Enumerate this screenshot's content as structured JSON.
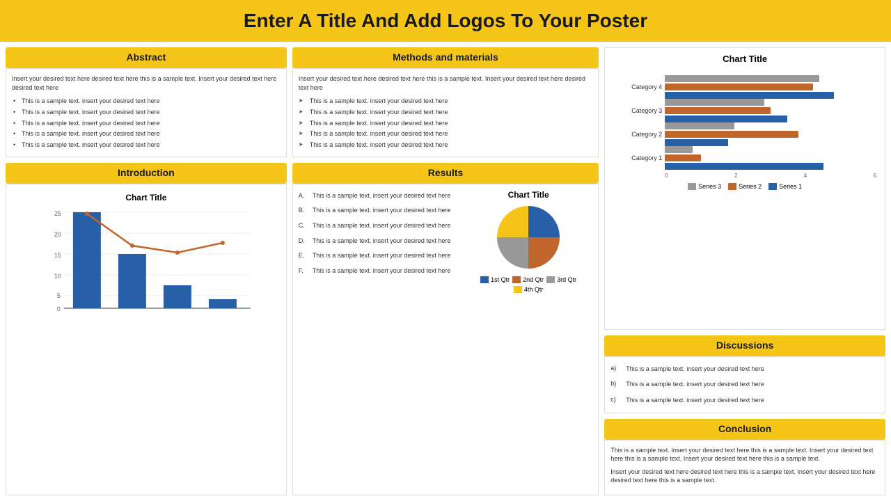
{
  "header": {
    "title": "Enter A Title And Add Logos To Your Poster"
  },
  "abstract": {
    "header": "Abstract",
    "body": "Insert your desired text here desired text here this is a sample text. Insert your desired text here desired text here",
    "bullets": [
      "This is a sample text. insert your desired text here",
      "This is a sample text. insert your desired text here",
      "This is a sample text. insert your desired text here",
      "This is a sample text. insert your desired text here",
      "This is a sample text. insert your desired text here"
    ]
  },
  "methods": {
    "header": "Methods and materials",
    "body": "Insert your desired text here desired text here this is a sample text. Insert your desired text here desired text here",
    "bullets": [
      "This is a sample text. insert your desired text here",
      "This is a sample text. insert your desired text here",
      "This is a sample text. insert your desired text here",
      "This is a sample text. insert your desired text here",
      "This is a sample text. insert your desired text here"
    ]
  },
  "introduction": {
    "header": "Introduction",
    "chart_title": "Chart Title"
  },
  "results": {
    "header": "Results",
    "chart_title": "Chart Title",
    "items": [
      {
        "label": "A.",
        "text": "This is a sample text. insert your desired text here"
      },
      {
        "label": "B.",
        "text": "This is a sample text. insert your desired text here"
      },
      {
        "label": "C.",
        "text": "This is a sample text. insert your desired text here"
      },
      {
        "label": "D.",
        "text": "This is a sample text. insert your desired text here"
      },
      {
        "label": "E.",
        "text": "This is a sample text. insert your desired text here"
      },
      {
        "label": "F.",
        "text": "This is a sample text. insert your desired text here"
      }
    ],
    "pie_legend": [
      {
        "label": "1st Qtr",
        "color": "#2860a8"
      },
      {
        "label": "2nd Qtr",
        "color": "#c0652b"
      },
      {
        "label": "3rd Qtr",
        "color": "#999"
      },
      {
        "label": "4th Qtr",
        "color": "#F5C518"
      }
    ]
  },
  "barchart": {
    "title": "Chart Title",
    "categories": [
      "Category 4",
      "Category 3",
      "Category 2",
      "Category 1"
    ],
    "series": [
      {
        "name": "Series 3",
        "color": "#999",
        "values": [
          4.4,
          2.8,
          2.0,
          0.8
        ]
      },
      {
        "name": "Series 2",
        "color": "#c0652b",
        "values": [
          4.2,
          3.0,
          3.8,
          1.0
        ]
      },
      {
        "name": "Series 1",
        "color": "#2860a8",
        "values": [
          4.8,
          3.5,
          1.8,
          4.5
        ]
      }
    ],
    "axis": [
      "0",
      "2",
      "4",
      "6"
    ]
  },
  "discussions": {
    "header": "Discussions",
    "items": [
      {
        "label": "a)",
        "text": "This is a sample text. insert your desired text here"
      },
      {
        "label": "b)",
        "text": "This is a sample text. insert your desired text here"
      },
      {
        "label": "c)",
        "text": "This is a sample text. insert your desired text here"
      }
    ]
  },
  "conclusion": {
    "header": "Conclusion",
    "paragraphs": [
      "This is a sample text. Insert your desired text here this is a sample text. Insert your desired text here this is a sample text. Insert your desired text here this is a sample text.",
      "Insert your desired text here desired text here this is a sample text. Insert your desired text here desired text here this is a sample text."
    ]
  }
}
